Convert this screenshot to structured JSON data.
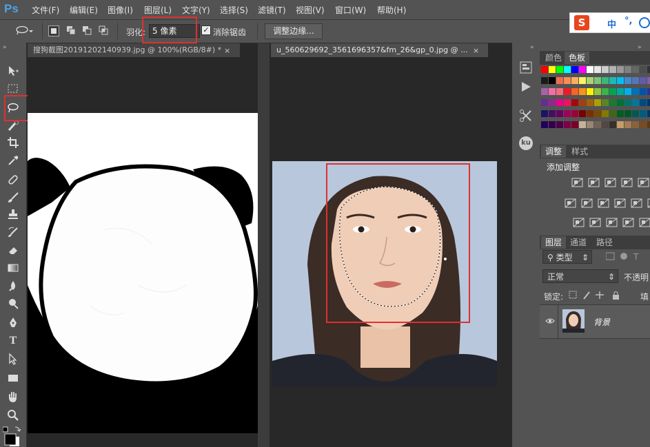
{
  "app": {
    "logo": "Ps",
    "menu": [
      "文件(F)",
      "编辑(E)",
      "图像(I)",
      "图层(L)",
      "文字(Y)",
      "选择(S)",
      "滤镜(T)",
      "视图(V)",
      "窗口(W)",
      "帮助(H)"
    ]
  },
  "ime": {
    "logo": "S",
    "lang": "中",
    "punct": "°,"
  },
  "options": {
    "feather_label": "羽化:",
    "feather_value": "5 像素",
    "antialias_label": "消除锯齿",
    "antialias_checked": true,
    "refine_edge": "调整边缘..."
  },
  "tabs": [
    {
      "title": "搜狗截图20191202140939.jpg @ 100%(RGB/8#) *",
      "close": "×"
    },
    {
      "title": "u_560629692_3561696357&fm_26&gp_0.jpg @ ...",
      "close": "×"
    }
  ],
  "panels": {
    "color_tabs": [
      "颜色",
      "色板"
    ],
    "adjust_tabs": [
      "调整",
      "样式"
    ],
    "adjust_title": "添加调整",
    "layer_tabs": [
      "图层",
      "通道",
      "路径"
    ],
    "layer_kind": "类型",
    "blend_mode": "正常",
    "opacity_label": "不透明",
    "lock_label": "锁定:",
    "fill_label": "填",
    "layer_name": "背景"
  },
  "icons": {
    "ku": "ku"
  },
  "colors": {
    "accent": "#4aa3e8",
    "highlight_box": "#e03030"
  }
}
